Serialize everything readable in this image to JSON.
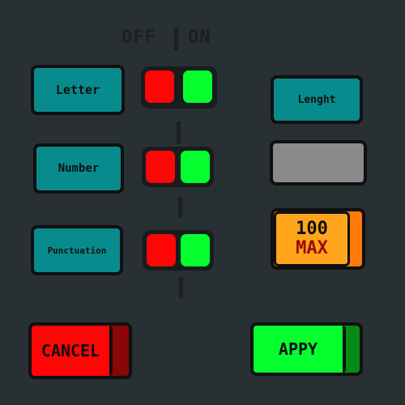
{
  "header": {
    "off_label": "OFF",
    "on_label": "ON"
  },
  "options": [
    {
      "label": "Letter"
    },
    {
      "label": "Number"
    },
    {
      "label": "Punctuation"
    }
  ],
  "length": {
    "label": "Lenght",
    "value": ""
  },
  "max": {
    "number": "100",
    "label": "MAX"
  },
  "actions": {
    "cancel_label": "CANCEL",
    "apply_label": "APPY"
  },
  "colors": {
    "background": "#283033",
    "teal": "#088b8c",
    "off_red": "#ff0505",
    "on_green": "#05ff2e",
    "max_orange": "#ffa51c"
  }
}
